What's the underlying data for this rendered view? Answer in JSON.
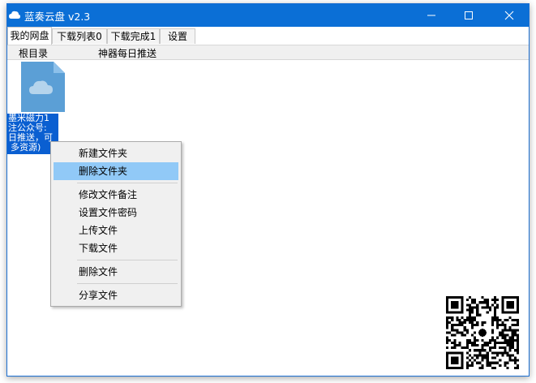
{
  "window": {
    "title": "蓝奏云盘  v2.3",
    "controls": {
      "minimize": "—",
      "maximize": "☐",
      "close": "✕"
    }
  },
  "tabs": [
    {
      "label": "我的网盘",
      "active": true
    },
    {
      "label": "下载列表0",
      "active": false
    },
    {
      "label": "下载完成1",
      "active": false
    },
    {
      "label": "设置",
      "active": false
    }
  ],
  "path_bar": {
    "root": "根目录",
    "folder": "神器每日推送"
  },
  "file_item": {
    "icon": "cloud-folder-icon",
    "label_lines": [
      "墨米磁力1",
      "注公众号:",
      "日推送，可",
      "多资源)"
    ]
  },
  "context_menu": {
    "items": [
      {
        "label": "新建文件夹",
        "highlighted": false
      },
      {
        "label": "删除文件夹",
        "highlighted": true
      },
      {
        "label": "修改文件备注",
        "highlighted": false
      },
      {
        "label": "设置文件密码",
        "highlighted": false
      },
      {
        "label": "上传文件",
        "highlighted": false
      },
      {
        "label": "下载文件",
        "highlighted": false
      },
      {
        "label": "删除文件",
        "highlighted": false
      },
      {
        "label": "分享文件",
        "highlighted": false
      }
    ]
  },
  "colors": {
    "titlebar": "#0b6fd6",
    "selection": "#0a5fd1",
    "menu_highlight": "#91c9f7",
    "icon_blue": "#5b9fd6"
  },
  "qr_code": {
    "icon": "qr-code-icon"
  }
}
